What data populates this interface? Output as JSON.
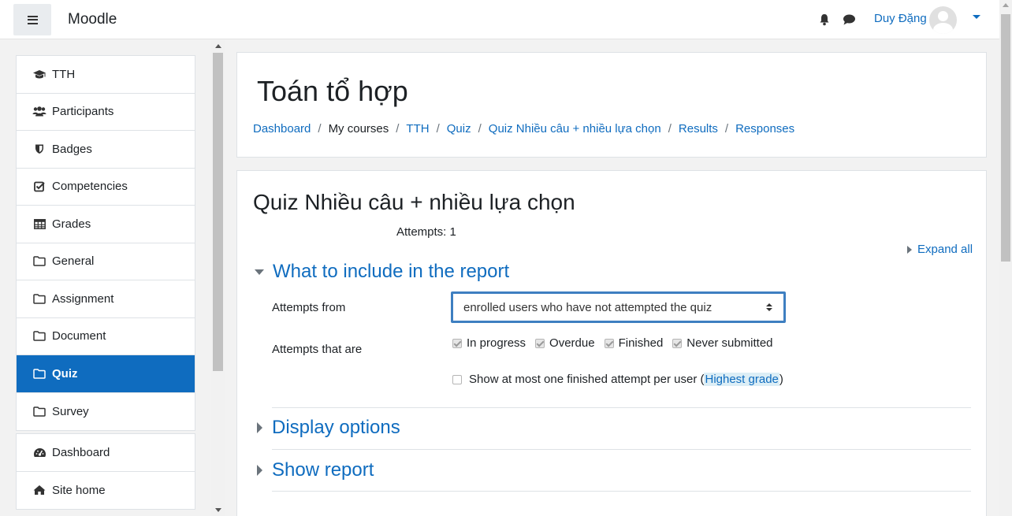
{
  "navbar": {
    "brand": "Moodle",
    "user_name": "Duy Đặng"
  },
  "drawer": {
    "course_items": [
      {
        "label": "TTH",
        "icon": "graduation-cap-icon"
      },
      {
        "label": "Participants",
        "icon": "users-icon"
      },
      {
        "label": "Badges",
        "icon": "shield-icon"
      },
      {
        "label": "Competencies",
        "icon": "check-square-icon"
      },
      {
        "label": "Grades",
        "icon": "table-icon"
      },
      {
        "label": "General",
        "icon": "folder-icon"
      },
      {
        "label": "Assignment",
        "icon": "folder-icon"
      },
      {
        "label": "Document",
        "icon": "folder-icon"
      },
      {
        "label": "Quiz",
        "icon": "folder-icon",
        "active": true
      },
      {
        "label": "Survey",
        "icon": "folder-icon"
      }
    ],
    "site_items": [
      {
        "label": "Dashboard",
        "icon": "dashboard-icon"
      },
      {
        "label": "Site home",
        "icon": "home-icon"
      }
    ]
  },
  "header": {
    "title": "Toán tổ hợp",
    "breadcrumb": [
      {
        "label": "Dashboard",
        "link": true
      },
      {
        "label": "My courses",
        "link": false
      },
      {
        "label": "TTH",
        "link": true
      },
      {
        "label": "Quiz",
        "link": true
      },
      {
        "label": "Quiz Nhiều câu + nhiều lựa chọn",
        "link": true
      },
      {
        "label": "Results",
        "link": true
      },
      {
        "label": "Responses",
        "link": true
      }
    ]
  },
  "main": {
    "quiz_title": "Quiz Nhiều câu + nhiều lựa chọn",
    "attempts": "Attempts: 1",
    "expand_all": "Expand all",
    "section_include": "What to include in the report",
    "attempts_from_label": "Attempts from",
    "attempts_from_value": "enrolled users who have not attempted the quiz",
    "attempts_that_are_label": "Attempts that are",
    "states": [
      {
        "label": "In progress",
        "checked": true
      },
      {
        "label": "Overdue",
        "checked": true
      },
      {
        "label": "Finished",
        "checked": true
      },
      {
        "label": "Never submitted",
        "checked": true
      }
    ],
    "show_one_prefix": "Show at most one finished attempt per user (",
    "show_one_link": "Highest grade",
    "show_one_suffix": ")",
    "section_display": "Display options",
    "section_show": "Show report"
  }
}
